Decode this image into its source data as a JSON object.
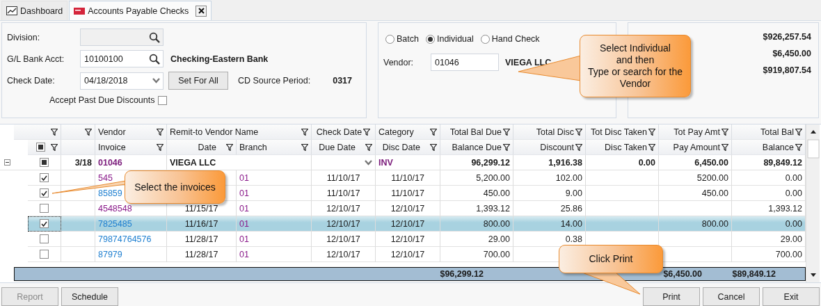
{
  "tabs": [
    {
      "label": "Dashboard",
      "selected": false,
      "closable": false
    },
    {
      "label": "Accounts Payable Checks",
      "selected": true,
      "closable": true
    }
  ],
  "header_form": {
    "division": {
      "label": "Division:"
    },
    "gl_bank_acct": {
      "label": "G/L Bank Acct:",
      "value": "10100100",
      "description": "Checking-Eastern Bank"
    },
    "check_date": {
      "label": "Check Date:",
      "value": "04/18/2018"
    },
    "set_for_all": "Set For All",
    "cd_source_period": {
      "label": "CD Source Period:",
      "value": "0317"
    },
    "accept_past_due": {
      "label": "Accept Past Due Discounts",
      "checked": false
    }
  },
  "check_type": {
    "options": [
      {
        "label": "Batch",
        "selected": false
      },
      {
        "label": "Individual",
        "selected": true
      },
      {
        "label": "Hand Check",
        "selected": false
      }
    ],
    "vendor": {
      "label": "Vendor:",
      "value": "01046",
      "name": "VIEGA LLC"
    }
  },
  "bank_summary": {
    "amounts": [
      "$926,257.54",
      "$6,450.00",
      "$919,807.54"
    ]
  },
  "grid": {
    "header_row_1": [
      "Vendor",
      "Remit-to Vendor Name",
      "Check Date",
      "Category",
      "Total Bal Due",
      "Total Disc",
      "Tot Disc Taken",
      "Tot Pay Amt",
      "Total Bal"
    ],
    "header_row_2": [
      "Invoice",
      "Date",
      "Branch",
      "Due Date",
      "Disc Date",
      "Balance Due",
      "Discount",
      "Disc Taken",
      "Pay Amount",
      "Balance"
    ],
    "select_all_partial": true,
    "group": {
      "expanded": true,
      "partial": true,
      "count": "3/18",
      "vendor": "01046",
      "name": "VIEGA LLC",
      "category": "INV",
      "bal_due": "96,299.12",
      "disc": "1,916.38",
      "disc_taken": "0.00",
      "pay": "6,450.00",
      "balance": "89,849.12"
    },
    "rows": [
      {
        "checked": true,
        "selected": false,
        "visited": true,
        "invoice": "545",
        "branch": "01",
        "due_date": "11/10/17",
        "disc_date": "11/10/17",
        "bal_due": "5,200.00",
        "disc": "102.00",
        "pay": "5200.00",
        "balance": "0.00"
      },
      {
        "checked": true,
        "selected": false,
        "visited": false,
        "invoice": "85859",
        "branch": "01",
        "due_date": "11/10/17",
        "disc_date": "11/10/17",
        "bal_due": "450.00",
        "disc": "9.00",
        "pay": "450.00",
        "balance": "0.00"
      },
      {
        "checked": false,
        "selected": false,
        "visited": true,
        "invoice": "4548548",
        "date": "11/15/17",
        "branch": "01",
        "due_date": "12/10/17",
        "disc_date": "12/10/17",
        "bal_due": "1,393.12",
        "disc": "25.86",
        "balance": "1,393.12"
      },
      {
        "checked": true,
        "selected": true,
        "visited": false,
        "invoice": "7825485",
        "date": "11/16/17",
        "branch": "01",
        "due_date": "12/10/17",
        "disc_date": "12/10/17",
        "bal_due": "800.00",
        "disc": "14.00",
        "pay": "800.00",
        "balance": "0.00"
      },
      {
        "checked": false,
        "selected": false,
        "visited": false,
        "invoice": "79874764576",
        "date": "11/28/17",
        "branch": "01",
        "due_date": "12/10/17",
        "disc_date": "12/10/17",
        "bal_due": "29.00",
        "disc": "0.38",
        "balance": "29.00"
      },
      {
        "checked": false,
        "selected": false,
        "visited": false,
        "invoice": "87979",
        "date": "11/28/17",
        "branch": "01",
        "due_date": "12/10/17",
        "disc_date": "12/10/17",
        "bal_due": "700.00",
        "balance": "700.00"
      }
    ],
    "totals": {
      "bal_due": "$96,299.12",
      "pay": "$6,450.00",
      "balance": "$89,849.12"
    }
  },
  "buttons_left": [
    {
      "label": "Report",
      "disabled": true
    },
    {
      "label": "Schedule",
      "disabled": false
    }
  ],
  "buttons_right": [
    {
      "label": "Print",
      "disabled": false
    },
    {
      "label": "Cancel",
      "disabled": false
    },
    {
      "label": "Exit",
      "disabled": false
    }
  ],
  "callouts": [
    {
      "lines": [
        "Select Individual",
        "and then",
        "Type or search for the",
        "Vendor"
      ]
    },
    {
      "lines": [
        "Select the invoices"
      ]
    },
    {
      "lines": [
        "Click Print"
      ]
    }
  ]
}
